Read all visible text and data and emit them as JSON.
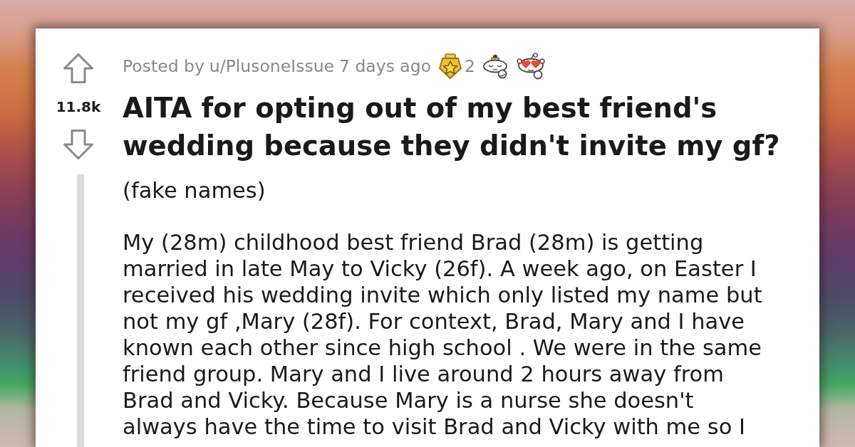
{
  "post": {
    "vote": {
      "score": "11.8k"
    },
    "meta": {
      "posted_by": "Posted by",
      "author": "u/PlusoneIssue",
      "time": "7 days ago",
      "awards": [
        {
          "kind": "star",
          "count": "2"
        },
        {
          "kind": "sleepy"
        },
        {
          "kind": "heart_eyes"
        }
      ]
    },
    "title": "AITA for opting out of my best friend's wedding because they didn't invite my gf?",
    "body": [
      "(fake names)",
      "My (28m) childhood best friend Brad (28m) is getting married in late May to Vicky (26f). A week ago, on Easter I received his wedding invite which only listed my name but not my gf ,Mary (28f). For context, Brad, Mary and I have known each other since high school . We were in the same friend group. Mary and I live around 2 hours away from Brad and Vicky. Because Mary is a nurse she doesn't always have the time to visit Brad and Vicky with me so I"
    ]
  }
}
